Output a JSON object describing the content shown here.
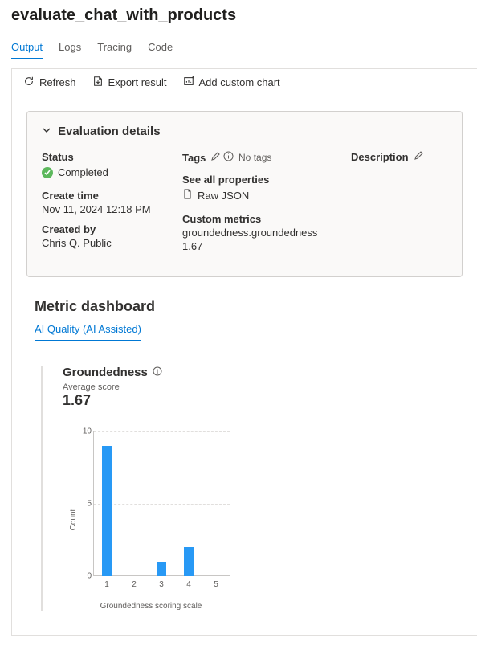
{
  "page_title": "evaluate_chat_with_products",
  "tabs": [
    "Output",
    "Logs",
    "Tracing",
    "Code"
  ],
  "active_tab_index": 0,
  "toolbar": {
    "refresh": "Refresh",
    "export": "Export result",
    "add_chart": "Add custom chart"
  },
  "details": {
    "header": "Evaluation details",
    "status_label": "Status",
    "status_value": "Completed",
    "create_time_label": "Create time",
    "create_time_value": "Nov 11, 2024 12:18 PM",
    "created_by_label": "Created by",
    "created_by_value": "Chris Q. Public",
    "tags_label": "Tags",
    "tags_value": "No tags",
    "see_all": "See all properties",
    "raw_json": "Raw JSON",
    "custom_metrics_label": "Custom metrics",
    "custom_metrics_name": "groundedness.groundedness",
    "custom_metrics_value": "1.67",
    "description_label": "Description"
  },
  "dashboard": {
    "title": "Metric dashboard",
    "tab": "AI Quality (AI Assisted)"
  },
  "chart": {
    "title": "Groundedness",
    "subtitle": "Average score",
    "score": "1.67"
  },
  "chart_data": {
    "type": "bar",
    "title": "Groundedness",
    "categories": [
      "1",
      "2",
      "3",
      "4",
      "5"
    ],
    "values": [
      9,
      0,
      1,
      2,
      0
    ],
    "xlabel": "Groundedness scoring scale",
    "ylabel": "Count",
    "yticks": [
      0,
      5,
      10
    ],
    "ylim": [
      0,
      10
    ]
  }
}
